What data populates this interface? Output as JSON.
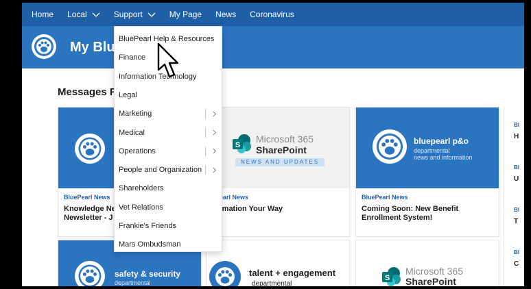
{
  "nav": {
    "items": [
      {
        "label": "Home",
        "has_chevron": false
      },
      {
        "label": "Local",
        "has_chevron": true
      },
      {
        "label": "Support",
        "has_chevron": true
      },
      {
        "label": "My Page",
        "has_chevron": false
      },
      {
        "label": "News",
        "has_chevron": false
      },
      {
        "label": "Coronavirus",
        "has_chevron": false
      }
    ]
  },
  "site": {
    "title": "My Blue"
  },
  "section": {
    "title": "Messages F"
  },
  "dropdown": {
    "items": [
      {
        "label": "BluePearl Help & Resources",
        "submenu": false
      },
      {
        "label": "Finance",
        "submenu": false
      },
      {
        "label": "Information Technology",
        "submenu": false
      },
      {
        "label": "Legal",
        "submenu": false
      },
      {
        "label": "Marketing",
        "submenu": true
      },
      {
        "label": "Medical",
        "submenu": true
      },
      {
        "label": "Operations",
        "submenu": true
      },
      {
        "label": "People and Organization",
        "submenu": true
      },
      {
        "label": "Shareholders",
        "submenu": false
      },
      {
        "label": "Vet Relations",
        "submenu": false
      },
      {
        "label": "Frankie's Friends",
        "submenu": false
      },
      {
        "label": "Mars Ombudsman",
        "submenu": false
      }
    ]
  },
  "cards": [
    {
      "category": "BluePearl News",
      "headline_line1": "Knowledge Ne",
      "headline_line2": "Newsletter - J"
    },
    {
      "category": "ePearl News",
      "headline_line1": "formation Your Way",
      "headline_line2": "",
      "ms_line1": "Microsoft 365",
      "ms_line2": "SharePoint",
      "ms_band": "NEWS AND UPDATES"
    },
    {
      "category": "BluePearl News",
      "headline_line1": "Coming Soon: New Benefit",
      "headline_line2": "Enrollment System!",
      "brand_title": "bluepearl p&o",
      "brand_sub1": "departmental",
      "brand_sub2": "news and information"
    },
    {
      "brand_title": "safety & security",
      "brand_sub1": "departmental"
    },
    {
      "brand_title": "talent + engagement",
      "brand_sub1": "departmental"
    },
    {
      "ms_line1": "Microsoft 365",
      "ms_line2": "SharePoint"
    }
  ],
  "side_column": {
    "rows": [
      {
        "cat": "Bl",
        "text": "H"
      },
      {
        "cat": "Bl",
        "text": "U"
      },
      {
        "cat": "Bl",
        "text": "T"
      },
      {
        "cat": "Bl",
        "text": "C"
      }
    ]
  },
  "colors": {
    "nav_bg": "#1f5fa6",
    "header_bg": "#2b74c0",
    "accent": "#1f5fa6"
  },
  "icons": {
    "chevron": "chevron-down-icon",
    "submenu": "chevron-right-icon",
    "logo": "paw-icon",
    "cursor": "mouse-pointer-icon"
  }
}
